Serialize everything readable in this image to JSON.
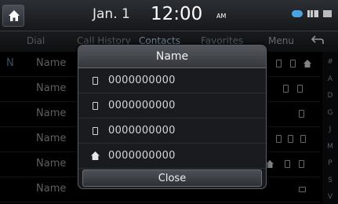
{
  "status": {
    "date": "Jan.  1",
    "time": "12:00",
    "ampm": "AM"
  },
  "tabs": [
    {
      "label": "Dial"
    },
    {
      "label": "Call History"
    },
    {
      "label": "Contacts"
    },
    {
      "label": "Favorites"
    }
  ],
  "menu_label": "Menu",
  "back_icon": "back-arrow-icon",
  "list": {
    "letter": "N",
    "rows": [
      {
        "name": "Name"
      },
      {
        "name": "Name"
      },
      {
        "name": "Name"
      },
      {
        "name": "Name"
      },
      {
        "name": "Name"
      },
      {
        "name": "Name"
      }
    ]
  },
  "index": [
    "#",
    "A",
    "D",
    "G",
    "J",
    "M",
    "P",
    "S",
    "V"
  ],
  "popup": {
    "title": "Name",
    "numbers": [
      {
        "icon": "mobile-phone-icon",
        "number": "0000000000"
      },
      {
        "icon": "mobile-phone-icon",
        "number": "0000000000"
      },
      {
        "icon": "mobile-phone-icon",
        "number": "0000000000"
      },
      {
        "icon": "home-icon",
        "number": "0000000000"
      }
    ],
    "close_label": "Close"
  }
}
